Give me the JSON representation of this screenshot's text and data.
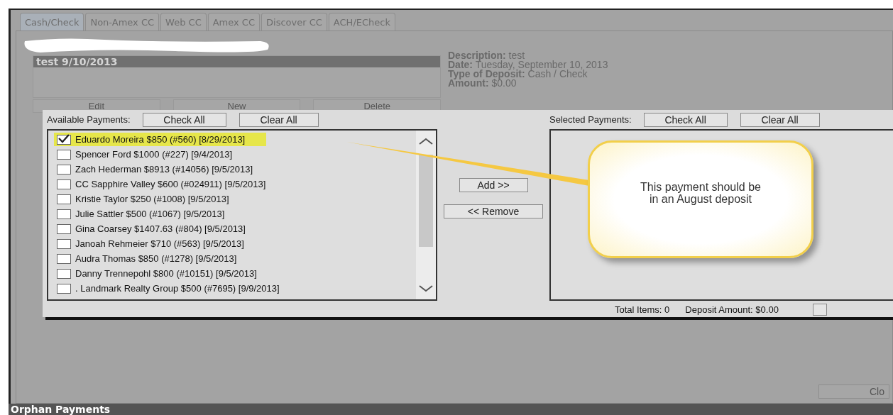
{
  "tabs": [
    {
      "label": "Cash/Check",
      "selected": true
    },
    {
      "label": "Non-Amex CC",
      "selected": false
    },
    {
      "label": "Web CC",
      "selected": false
    },
    {
      "label": "Amex CC",
      "selected": false
    },
    {
      "label": "Discover CC",
      "selected": false
    },
    {
      "label": "ACH/ECheck",
      "selected": false
    }
  ],
  "deposits": {
    "items": [
      {
        "label": "test 9/10/2013",
        "selected": true
      }
    ],
    "buttons": [
      "Edit",
      "New",
      "Delete"
    ]
  },
  "details": [
    {
      "label": "Description:",
      "value": "test"
    },
    {
      "label": "Date:",
      "value": "Tuesday, September 10, 2013"
    },
    {
      "label": "Type of Deposit:",
      "value": "Cash / Check"
    },
    {
      "label": "Amount:",
      "value": "$0.00"
    }
  ],
  "dialog": {
    "available": {
      "label": "Available Payments:",
      "buttons": [
        "Check All",
        "Clear All"
      ],
      "items": [
        {
          "label": "Eduardo Moreira $850 (#560) [8/29/2013]",
          "checked": true,
          "highlighted": true
        },
        {
          "label": "Spencer Ford $1000 (#227) [9/4/2013]",
          "checked": false,
          "highlighted": false
        },
        {
          "label": "Zach Hederman $8913 (#14056) [9/5/2013]",
          "checked": false,
          "highlighted": false
        },
        {
          "label": "CC Sapphire Valley $600 (#024911) [9/5/2013]",
          "checked": false,
          "highlighted": false
        },
        {
          "label": "Kristie Taylor $250 (#1008) [9/5/2013]",
          "checked": false,
          "highlighted": false
        },
        {
          "label": "Julie Sattler $500 (#1067) [9/5/2013]",
          "checked": false,
          "highlighted": false
        },
        {
          "label": "Gina Coarsey $1407.63 (#804) [9/5/2013]",
          "checked": false,
          "highlighted": false
        },
        {
          "label": "Janoah Rehmeier $710 (#563) [9/5/2013]",
          "checked": false,
          "highlighted": false
        },
        {
          "label": "Audra Thomas $850 (#1278) [9/5/2013]",
          "checked": false,
          "highlighted": false
        },
        {
          "label": "Danny Trennepohl $800 (#10151) [9/5/2013]",
          "checked": false,
          "highlighted": false
        },
        {
          "label": ". Landmark Realty Group $500 (#7695) [9/9/2013]",
          "checked": false,
          "highlighted": false
        }
      ]
    },
    "move_buttons": [
      "Add >>",
      "<< Remove"
    ],
    "selected": {
      "label": "Selected Payments:",
      "buttons": [
        "Check All",
        "Clear All"
      ]
    },
    "totals": [
      {
        "label": "Total Items:",
        "value": "0"
      },
      {
        "label": "Deposit Amount:",
        "value": "$0.00"
      }
    ]
  },
  "callout": {
    "text": "This payment should be in an August deposit"
  },
  "close_button": "Clo",
  "footer": {
    "title": "Orphan Payments"
  }
}
